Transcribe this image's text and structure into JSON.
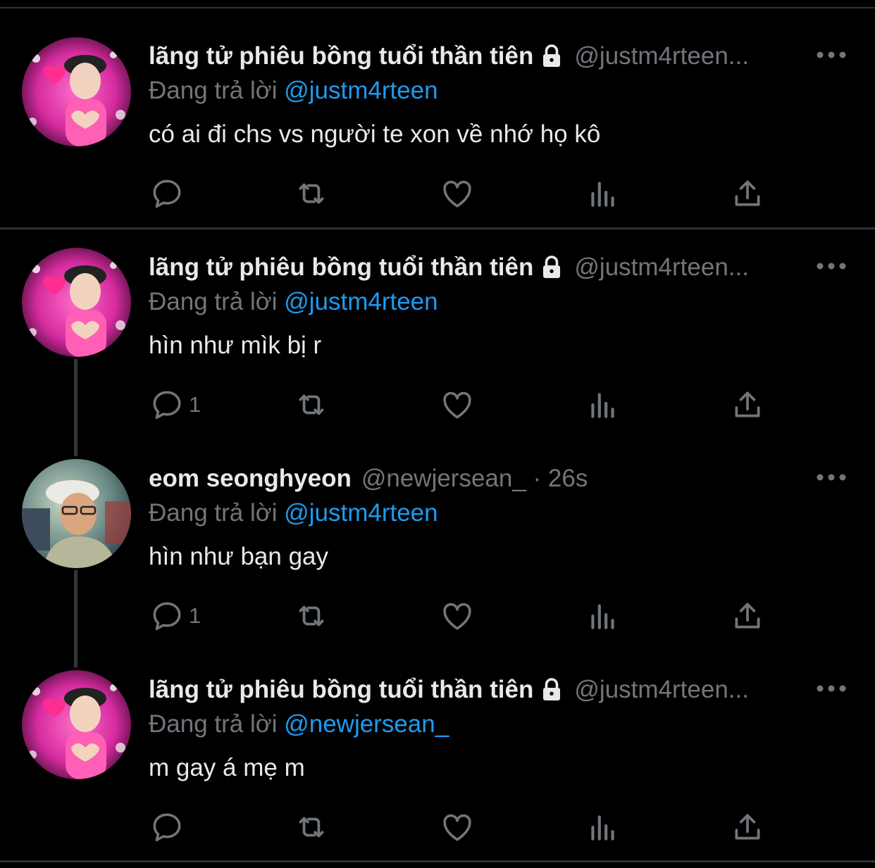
{
  "colors": {
    "accent": "#1d9bf0",
    "muted": "#71767b",
    "text": "#e7e9ea",
    "background": "#000000"
  },
  "tweets": [
    {
      "name": "lãng tử phiêu bồng tuổi thần tiên",
      "handle": "@justm4rteen...",
      "locked": true,
      "replying_prefix": "Đang trả lời",
      "replying_to": "@justm4rteen",
      "text": "có ai đi chs vs người te xon về nhớ họ kô",
      "reply_count": ""
    },
    {
      "name": "lãng tử phiêu bồng tuổi thần tiên",
      "handle": "@justm4rteen...",
      "locked": true,
      "replying_prefix": "Đang trả lời",
      "replying_to": "@justm4rteen",
      "text": "hìn như mìk bị r",
      "reply_count": "1"
    },
    {
      "name": "eom seonghyeon",
      "handle": "@newjersean_ · 26s",
      "locked": false,
      "replying_prefix": "Đang trả lời",
      "replying_to": "@justm4rteen",
      "text": "hìn như bạn gay",
      "reply_count": "1"
    },
    {
      "name": "lãng tử phiêu bồng tuổi thần tiên",
      "handle": "@justm4rteen...",
      "locked": true,
      "replying_prefix": "Đang trả lời",
      "replying_to": "@newjersean_",
      "text": "m gay á mẹ m",
      "reply_count": ""
    }
  ]
}
